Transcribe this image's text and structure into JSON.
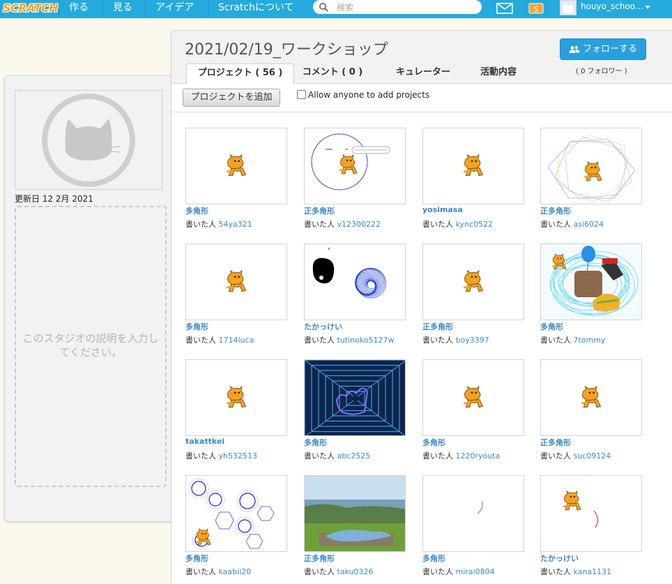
{
  "topbar": {
    "logo": "SCRATCH",
    "nav": [
      "作る",
      "見る",
      "アイデア",
      "Scratchについて"
    ],
    "search_placeholder": "検索",
    "username": "houyo_schoo…",
    "accent": "#25aadd"
  },
  "left": {
    "updated": "更新日 12 2月 2021",
    "description_placeholder": "このスタジオの説明を入力してください。"
  },
  "studio": {
    "title": "2021/02/19_ワークショップ",
    "follow_button": "フォローする",
    "followers": "( 0 フォロワー )",
    "tabs": [
      "プロジェクト ( 56 )",
      "コメント ( 0 )",
      "キュレーター",
      "活動内容"
    ],
    "add_button": "プロジェクトを追加",
    "allow_label": "Allow anyone to add projects"
  },
  "byline_prefix": "書いた人",
  "projects": [
    {
      "title": "多角形",
      "author": "54ya321",
      "thumb": "cat"
    },
    {
      "title": "正多角形",
      "author": "v12300222",
      "thumb": "circle-speech"
    },
    {
      "title": "yosimasa",
      "author": "kync0522",
      "thumb": "cat"
    },
    {
      "title": "正多角形",
      "author": "asi6024",
      "thumb": "polygons-color"
    },
    {
      "title": "多角形",
      "author": "1714luca",
      "thumb": "cat"
    },
    {
      "title": "たかっけい",
      "author": "tutinoko5127w",
      "thumb": "blob-spiral"
    },
    {
      "title": "正多角形",
      "author": "boy3397",
      "thumb": "cat"
    },
    {
      "title": "多角形",
      "author": "7tommy",
      "thumb": "collage"
    },
    {
      "title": "takattkei",
      "author": "yh532513",
      "thumb": "cat"
    },
    {
      "title": "多角形",
      "author": "abc2525",
      "thumb": "tunnel"
    },
    {
      "title": "多角形",
      "author": "1220ryouta",
      "thumb": "cat"
    },
    {
      "title": "正多角形",
      "author": "suc09124",
      "thumb": "cat"
    },
    {
      "title": "多角形",
      "author": "kaabii20",
      "thumb": "hexagons"
    },
    {
      "title": "正多角形",
      "author": "taku0326",
      "thumb": "photo"
    },
    {
      "title": "多角形",
      "author": "mirai0804",
      "thumb": "arc"
    },
    {
      "title": "たかっけい",
      "author": "kana1131",
      "thumb": "cat-arc"
    }
  ]
}
